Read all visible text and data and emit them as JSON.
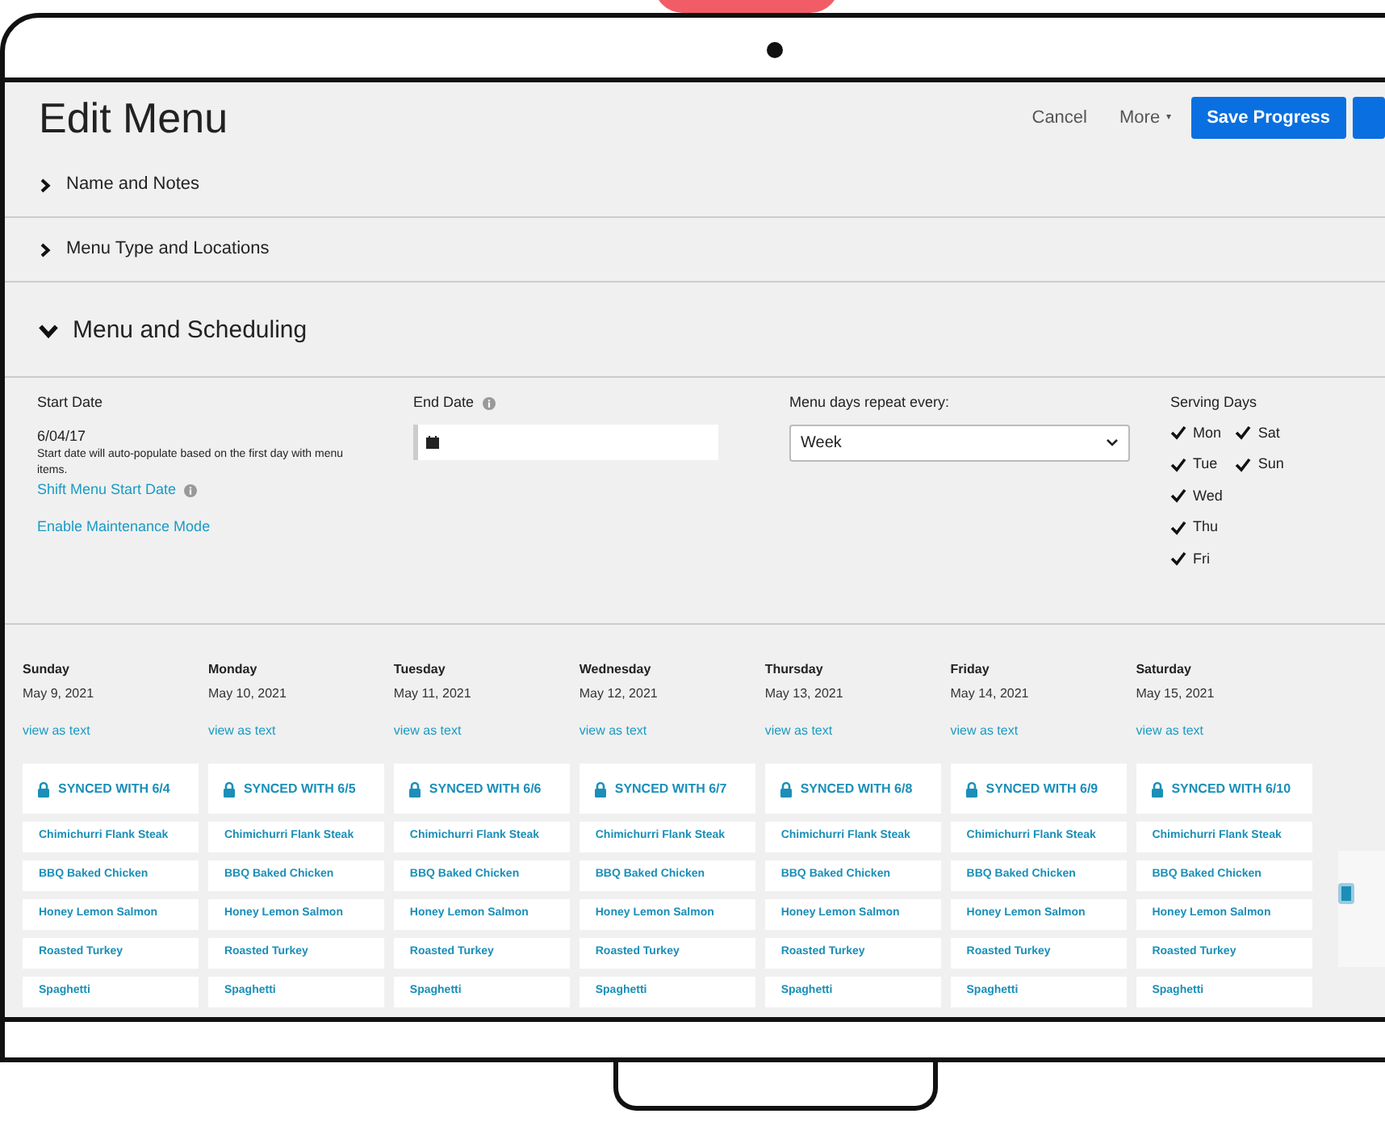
{
  "header": {
    "title": "Edit Menu",
    "actions": [
      {
        "kind": "link",
        "label": "Cancel"
      },
      {
        "kind": "dropdown",
        "label": "More",
        "caret": "▾"
      },
      {
        "kind": "primary",
        "label": "Save Progress"
      },
      {
        "kind": "primary"
      }
    ]
  },
  "sections": [
    {
      "title": "Name and Notes",
      "expanded": false
    },
    {
      "title": "Menu Type and Locations",
      "expanded": false
    },
    {
      "title": "Menu and Scheduling",
      "expanded": true
    }
  ],
  "start_date": {
    "label": "Start Date",
    "value": "6/04/17",
    "hint": "Start date will auto-populate based on the first day with menu items.",
    "shift_link": "Shift Menu Start Date",
    "maintenance_link": "Enable Maintenance Mode"
  },
  "end_date": {
    "label": "End Date"
  },
  "repeat": {
    "label": "Menu days repeat every:",
    "value": "Week"
  },
  "serving_days": {
    "label": "Serving Days",
    "days": [
      {
        "label": "Mon",
        "checked": true
      },
      {
        "label": "Tue",
        "checked": true
      },
      {
        "label": "Wed",
        "checked": true
      },
      {
        "label": "Thu",
        "checked": true
      },
      {
        "label": "Fri",
        "checked": true
      },
      {
        "label": "Sat",
        "checked": true
      },
      {
        "label": "Sun",
        "checked": true
      }
    ]
  },
  "days": [
    {
      "day": "Sunday",
      "date": "May 9, 2021",
      "link": "view as text",
      "synced": "SYNCED WITH 6/4",
      "items": [
        "Chimichurri Flank Steak",
        "BBQ Baked Chicken",
        "Honey Lemon Salmon",
        "Roasted Turkey",
        "Spaghetti"
      ]
    },
    {
      "day": "Monday",
      "date": "May 10, 2021",
      "link": "view as text",
      "synced": "SYNCED WITH 6/5",
      "items": [
        "Chimichurri Flank Steak",
        "BBQ Baked Chicken",
        "Honey Lemon Salmon",
        "Roasted Turkey",
        "Spaghetti"
      ]
    },
    {
      "day": "Tuesday",
      "date": "May 11, 2021",
      "link": "view as text",
      "synced": "SYNCED WITH 6/6",
      "items": [
        "Chimichurri Flank Steak",
        "BBQ Baked Chicken",
        "Honey Lemon Salmon",
        "Roasted Turkey",
        "Spaghetti"
      ]
    },
    {
      "day": "Wednesday",
      "date": "May 12, 2021",
      "link": "view as text",
      "synced": "SYNCED WITH 6/7",
      "items": [
        "Chimichurri Flank Steak",
        "BBQ Baked Chicken",
        "Honey Lemon Salmon",
        "Roasted Turkey",
        "Spaghetti"
      ]
    },
    {
      "day": "Thursday",
      "date": "May 13, 2021",
      "link": "view as text",
      "synced": "SYNCED WITH 6/8",
      "items": [
        "Chimichurri Flank Steak",
        "BBQ Baked Chicken",
        "Honey Lemon Salmon",
        "Roasted Turkey",
        "Spaghetti"
      ]
    },
    {
      "day": "Friday",
      "date": "May 14, 2021",
      "link": "view as text",
      "synced": "SYNCED WITH 6/9",
      "items": [
        "Chimichurri Flank Steak",
        "BBQ Baked Chicken",
        "Honey Lemon Salmon",
        "Roasted Turkey",
        "Spaghetti"
      ]
    },
    {
      "day": "Saturday",
      "date": "May 15, 2021",
      "link": "view as text",
      "synced": "SYNCED WITH 6/10",
      "items": [
        "Chimichurri Flank Steak",
        "BBQ Baked Chicken",
        "Honey Lemon Salmon",
        "Roasted Turkey",
        "Spaghetti"
      ]
    }
  ]
}
